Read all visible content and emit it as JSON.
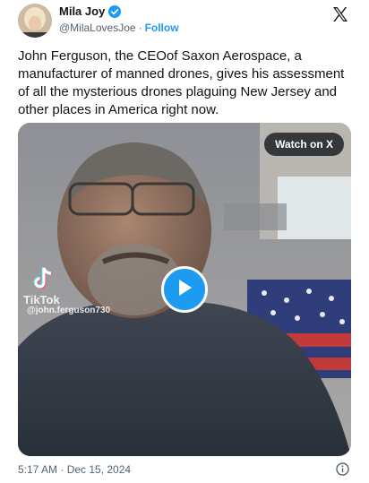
{
  "author": {
    "display_name": "Mila Joy",
    "handle": "@MilaLovesJoe",
    "separator": "·",
    "follow_label": "Follow",
    "verified_color": "#1d9bf0"
  },
  "icons": {
    "platform": "x-logo-icon",
    "verified": "verified-badge-icon",
    "play": "play-icon",
    "info": "info-icon",
    "watermark": "tiktok-logo-icon"
  },
  "tweet": {
    "text": "John Ferguson, the CEOof Saxon Aerospace, a manufacturer of manned drones, gives his assessment of all the mysterious drones plaguing New Jersey and other places in America right now."
  },
  "media": {
    "watch_label": "Watch on X",
    "watermark_brand": "TikTok",
    "watermark_user": "@john.ferguson730"
  },
  "footer": {
    "timestamp": "5:17 AM · Dec 15, 2024"
  },
  "colors": {
    "accent": "#1d9bf0",
    "text": "#0f1419",
    "muted": "#536471"
  }
}
